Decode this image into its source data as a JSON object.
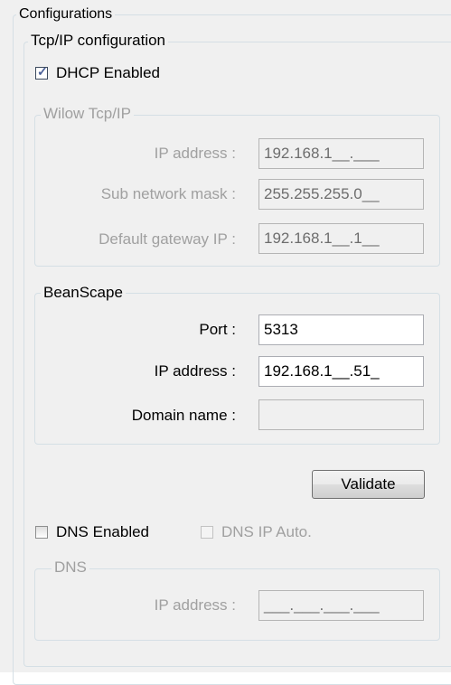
{
  "configurations": {
    "title": "Configurations",
    "tcpip": {
      "title": "Tcp/IP configuration",
      "dhcp": {
        "label": "DHCP Enabled",
        "checked": true
      },
      "wilow": {
        "title": "Wilow Tcp/IP",
        "ip_label": "IP address :",
        "ip_value": "192.168.1__.___",
        "mask_label": "Sub network mask :",
        "mask_value": "255.255.255.0__",
        "gateway_label": "Default gateway IP :",
        "gateway_value": "192.168.1__.1__"
      },
      "beanscape": {
        "title": "BeanScape",
        "port_label": "Port :",
        "port_value": "5313",
        "ip_label": "IP address :",
        "ip_value": "192.168.1__.51_",
        "domain_label": "Domain name :",
        "domain_value": ""
      },
      "validate_label": "Validate",
      "dns_enabled": {
        "label": "DNS Enabled",
        "checked": false
      },
      "dns_ip_auto": {
        "label": "DNS IP Auto.",
        "checked": false,
        "enabled": false
      },
      "dns": {
        "title": "DNS",
        "ip_label": "IP address :",
        "ip_value": "___.___.___.___"
      }
    }
  }
}
